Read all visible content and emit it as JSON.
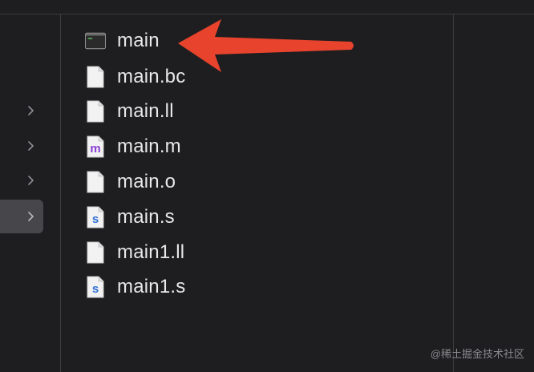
{
  "files": [
    {
      "name": "main",
      "icon": "terminal-exec-icon"
    },
    {
      "name": "main.bc",
      "icon": "blank-document-icon"
    },
    {
      "name": "main.ll",
      "icon": "blank-document-icon"
    },
    {
      "name": "main.m",
      "icon": "objc-source-icon"
    },
    {
      "name": "main.o",
      "icon": "blank-document-icon"
    },
    {
      "name": "main.s",
      "icon": "assembly-source-icon"
    },
    {
      "name": "main1.ll",
      "icon": "blank-document-icon"
    },
    {
      "name": "main1.s",
      "icon": "assembly-source-icon"
    }
  ],
  "left_column_chevrons": 4,
  "selected_left_row": 4,
  "annotation": {
    "type": "red-arrow",
    "points_to": "main",
    "color": "#e8432c"
  },
  "watermark": "@稀土掘金技术社区",
  "colors": {
    "background": "#1e1e21",
    "selected_row": "#47474b",
    "text": "#e8e8ea",
    "objc_icon_letter": "#8b3fd6",
    "asm_icon_letter": "#2f6fd3"
  }
}
